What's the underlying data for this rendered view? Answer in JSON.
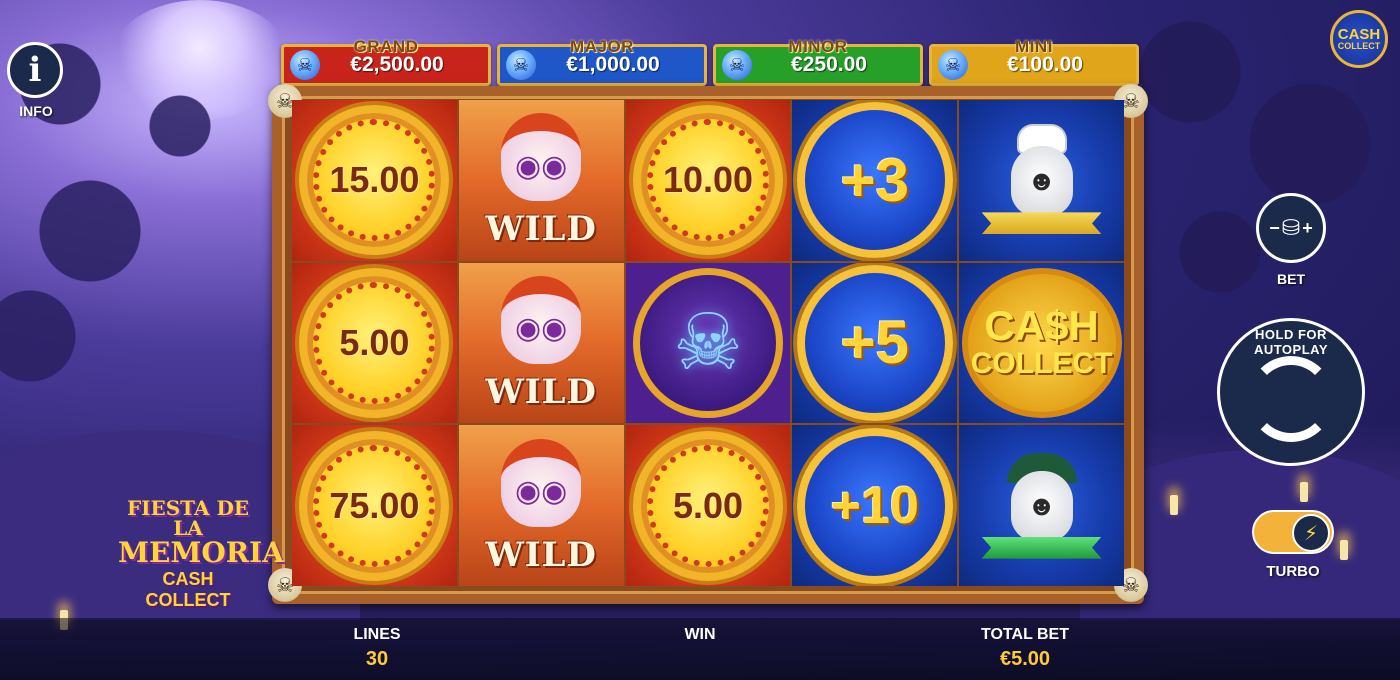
{
  "jackpots": [
    {
      "label": "GRAND",
      "value": "€2,500.00",
      "color": "#c8241c"
    },
    {
      "label": "MAJOR",
      "value": "€1,000.00",
      "color": "#1f56c8"
    },
    {
      "label": "MINOR",
      "value": "€250.00",
      "color": "#27a02a"
    },
    {
      "label": "MINI",
      "value": "€100.00",
      "color": "#e0a51a"
    }
  ],
  "reels": {
    "r0": {
      "c0": "15.00",
      "c1": "5.00",
      "c2": "75.00"
    },
    "wild_label": "WILD",
    "r2": {
      "c0": "10.00",
      "c2": "5.00"
    },
    "r3": {
      "c0": "+3",
      "c1": "+5",
      "c2": "+10"
    },
    "cash_collect": {
      "line1": "CA$H",
      "line2": "COLLECT"
    }
  },
  "side": {
    "info_label": "INFO",
    "bet_label": "BET",
    "autoplay_label": "HOLD FOR AUTOPLAY",
    "turbo_label": "TURBO",
    "badge_line1": "CASH",
    "badge_line2": "COLLECT"
  },
  "logo": {
    "line1": "FIESTA DE LA",
    "line2": "MEMORIA",
    "line3": "CASH COLLECT"
  },
  "bottom": {
    "lines_label": "LINES",
    "lines_value": "30",
    "win_label": "WIN",
    "win_value": "",
    "total_bet_label": "TOTAL BET",
    "total_bet_value": "€5.00"
  },
  "icons": [
    "info-icon",
    "coins-icon",
    "spin-icon",
    "lightning-icon",
    "blue-skull-icon"
  ]
}
